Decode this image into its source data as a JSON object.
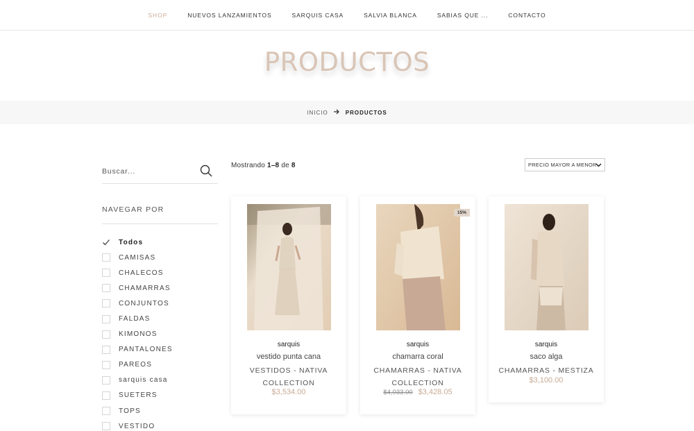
{
  "nav": {
    "items": [
      "SHOP",
      "NUEVOS LANZAMIENTOS",
      "SARQUIS CASA",
      "SALVIA BLANCA",
      "SABIAS QUE ...",
      "CONTACTO"
    ]
  },
  "hero": {
    "title": "PRODUCTOS"
  },
  "breadcrumb": {
    "home": "INICIO",
    "current": "PRODUCTOS"
  },
  "sidebar": {
    "search_placeholder": "Buscar...",
    "browse_title": "NAVEGAR POR",
    "filters": [
      {
        "label": "Todos",
        "checked": true
      },
      {
        "label": "CAMISAS",
        "checked": false
      },
      {
        "label": "CHALECOS",
        "checked": false
      },
      {
        "label": "CHAMARRAS",
        "checked": false
      },
      {
        "label": "CONJUNTOS",
        "checked": false
      },
      {
        "label": "FALDAS",
        "checked": false
      },
      {
        "label": "KIMONOS",
        "checked": false
      },
      {
        "label": "PANTALONES",
        "checked": false
      },
      {
        "label": "PAREOS",
        "checked": false
      },
      {
        "label": "sarquis casa",
        "checked": false
      },
      {
        "label": "SUETERS",
        "checked": false
      },
      {
        "label": "TOPS",
        "checked": false
      },
      {
        "label": "VESTIDO",
        "checked": false
      }
    ]
  },
  "results": {
    "prefix": "Mostrando",
    "range": "1–8",
    "of": "de",
    "total": "8"
  },
  "sort": {
    "selected": "PRECIO MAYOR A MENOR"
  },
  "products": [
    {
      "brand": "sarquis",
      "name": "vestido punta cana",
      "category": "VESTIDOS - NATIVA COLLECTION",
      "price": "$3,534.00",
      "old_price": "",
      "badge": ""
    },
    {
      "brand": "sarquis",
      "name": "chamarra coral",
      "category": "CHAMARRAS - NATIVA COLLECTION",
      "price": "$3,428.05",
      "old_price": "$4,033.00",
      "badge": "15%"
    },
    {
      "brand": "sarquis",
      "name": "saco alga",
      "category": "CHAMARRAS - MESTIZA",
      "price": "$3,100.00",
      "old_price": "",
      "badge": ""
    }
  ],
  "colors": {
    "accent": "#c9ab95",
    "title": "#d9c5b6",
    "bar": "#f7f7f7"
  },
  "icons": {
    "search": "search-icon",
    "check": "check-icon",
    "arrow": "arrow-right-icon",
    "chevron": "chevron-down-icon"
  }
}
